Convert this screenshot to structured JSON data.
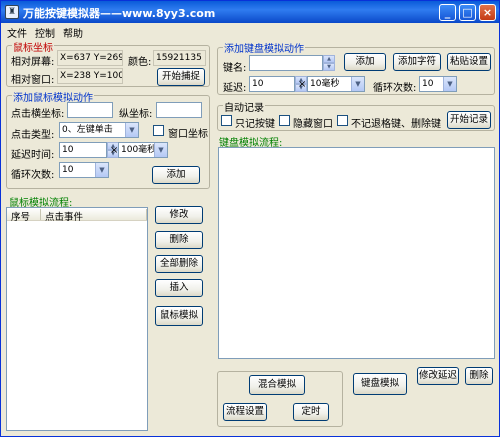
{
  "window": {
    "title": "万能按键模拟器——www.8yy3.com"
  },
  "menu": [
    "文件",
    "控制",
    "帮助"
  ],
  "mouse_coords": {
    "legend": "鼠标坐标",
    "screen_label": "相对屏幕:",
    "screen_value": "X=637  Y=269",
    "color_label": "颜色:",
    "color_value": "15921135",
    "window_label": "相对窗口:",
    "window_value": "X=238  Y=100",
    "capture_button": "开始捕捉"
  },
  "add_mouse": {
    "legend": "添加鼠标模拟动作",
    "click_x_label": "点击横坐标:",
    "click_x_value": "",
    "click_y_label": "纵坐标:",
    "click_y_value": "",
    "click_type_label": "点击类型:",
    "click_type_value": "0、左键单击",
    "window_coord_label": "窗口坐标",
    "delay_label": "延迟时间:",
    "delay_value": "10",
    "delay_unit": "100毫秒",
    "loop_label": "循环次数:",
    "loop_value": "10",
    "add_button": "添加"
  },
  "mouse_flow": {
    "title": "鼠标模拟流程:",
    "columns": [
      "序号",
      "点击事件"
    ]
  },
  "mouse_flow_buttons": [
    "修改",
    "删除",
    "全部删除",
    "插入",
    "鼠标模拟"
  ],
  "add_keyboard": {
    "legend": "添加键盘模拟动作",
    "key_label": "键名:",
    "key_value": "",
    "add_button": "添加",
    "add_chars_button": "添加字符",
    "paste_button": "粘贴设置",
    "delay_label": "延迟:",
    "delay_value": "10",
    "delay_unit": "10毫秒",
    "loop_label": "循环次数:",
    "loop_value": "10"
  },
  "auto_record": {
    "legend": "自动记录",
    "only_keys": "只记按键",
    "hide_window": "隐藏窗口",
    "ignore_keys": "不记退格键、删除键",
    "start_button": "开始记录"
  },
  "keyboard_flow": {
    "title": "键盘模拟流程:"
  },
  "bottom": {
    "mixed_button": "混合模拟",
    "keyboard_button": "键盘模拟",
    "modify_delay_button": "修改延迟",
    "delete_button": "删除",
    "flow_settings_button": "流程设置",
    "timer_button": "定时"
  },
  "colors": {
    "title_bar": "#0a5bd9",
    "legend_red": "#c00000",
    "legend_blue": "#0033cc",
    "label_green": "#008000"
  },
  "icons": [
    "app-icon",
    "minimize-icon",
    "maximize-icon",
    "close-icon",
    "dropdown-arrow-icon",
    "spin-up-icon",
    "spin-down-icon"
  ]
}
